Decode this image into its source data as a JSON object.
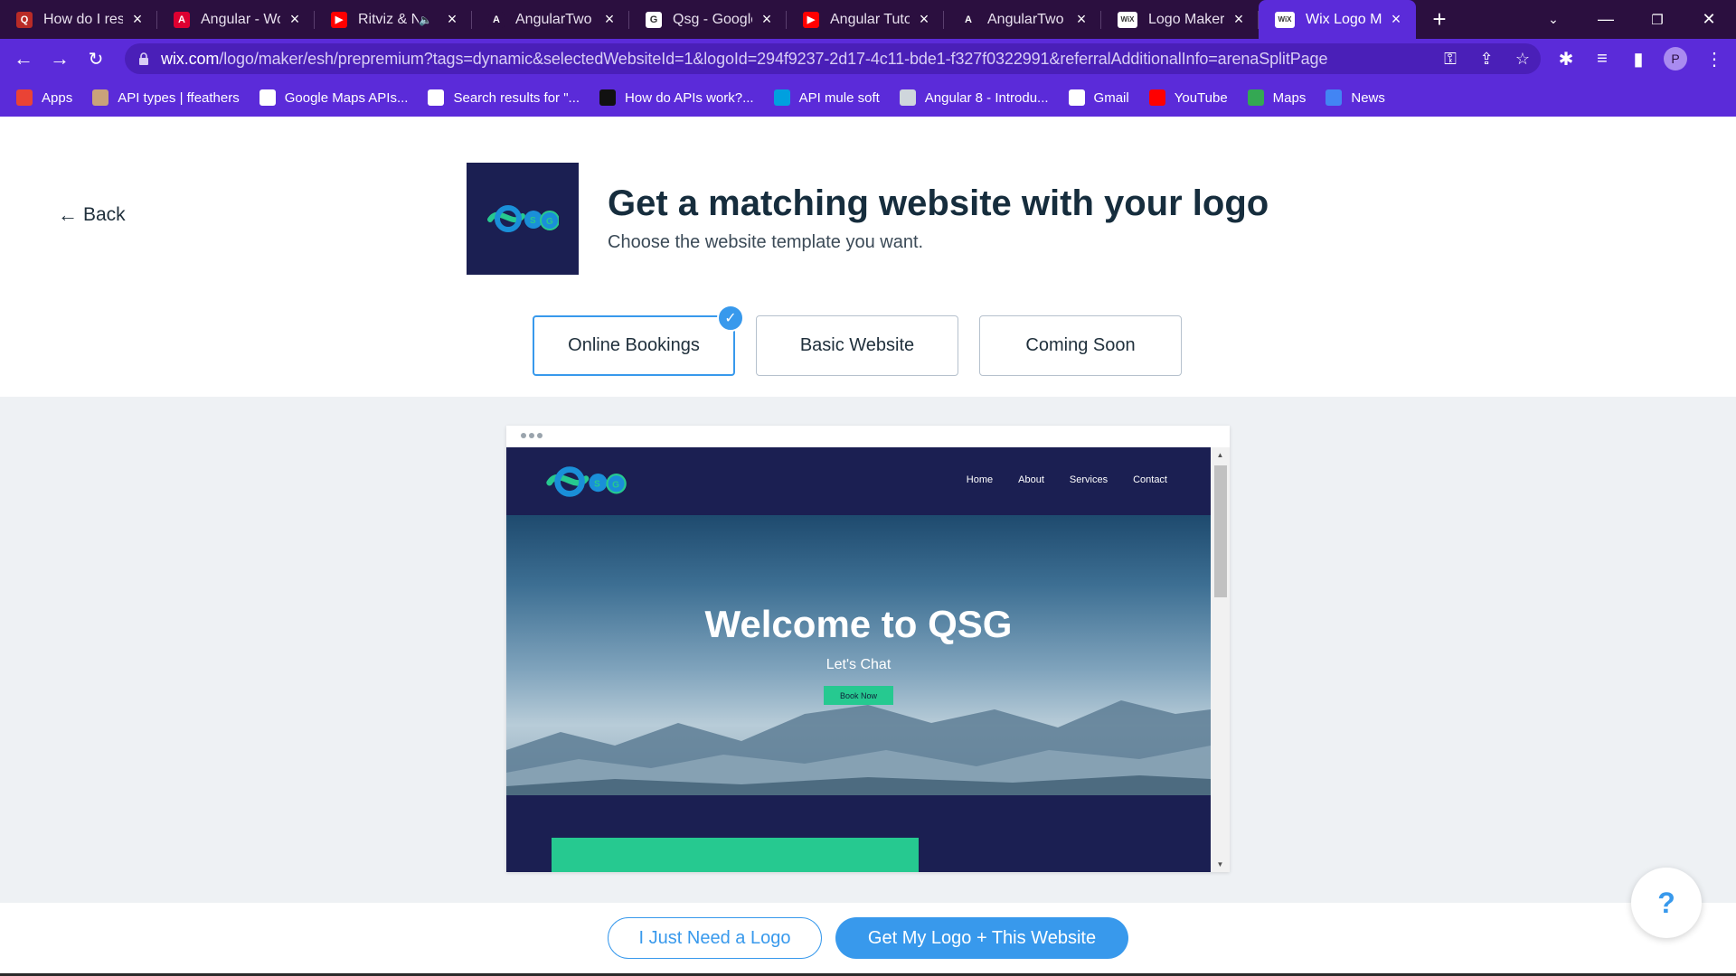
{
  "browser": {
    "tabs": [
      {
        "label": "How do I reso",
        "icon": "quora-icon",
        "color": "#b92b27",
        "glyph": "Q",
        "active": false,
        "audio": false
      },
      {
        "label": "Angular - Wor",
        "icon": "angular-icon",
        "color": "#dd0031",
        "glyph": "A",
        "active": false,
        "audio": false
      },
      {
        "label": "Ritviz & N",
        "icon": "youtube-icon",
        "color": "#ff0000",
        "glyph": "▶",
        "active": false,
        "audio": true
      },
      {
        "label": "AngularTwo",
        "icon": "angulartwo-icon",
        "color": "#2b0f3f",
        "glyph": "A",
        "active": false,
        "audio": false
      },
      {
        "label": "Qsg - Google",
        "icon": "google-icon",
        "color": "#ffffff",
        "glyph": "G",
        "active": false,
        "audio": false
      },
      {
        "label": "Angular Tutor",
        "icon": "youtube-icon",
        "color": "#ff0000",
        "glyph": "▶",
        "active": false,
        "audio": false
      },
      {
        "label": "AngularTwo",
        "icon": "angulartwo-icon",
        "color": "#2b0f3f",
        "glyph": "A",
        "active": false,
        "audio": false
      },
      {
        "label": "Logo Maker |",
        "icon": "wix-icon",
        "color": "#ffffff",
        "glyph": "WiX",
        "active": false,
        "audio": false
      },
      {
        "label": "Wix Logo Mak",
        "icon": "wix-icon",
        "color": "#ffffff",
        "glyph": "WiX",
        "active": true,
        "audio": false
      }
    ],
    "url_host": "wix.com",
    "url_rest": "/logo/maker/esh/prepremium?tags=dynamic&selectedWebsiteId=1&logoId=294f9237-2d17-4c11-bde1-f327f0322991&referralAdditionalInfo=arenaSplitPage",
    "profile_initial": "P",
    "bookmarks": [
      {
        "label": "Apps",
        "icon": "apps-grid-icon",
        "color": "#ea4335"
      },
      {
        "label": "API types | ffeathers",
        "icon": "ffeathers-icon",
        "color": "#c9a27a"
      },
      {
        "label": "Google Maps APIs...",
        "icon": "google-maps-api-icon",
        "color": "#ffffff"
      },
      {
        "label": "Search results for \"...",
        "icon": "search-results-icon",
        "color": "#ffffff"
      },
      {
        "label": "How do APIs work?...",
        "icon": "link-icon",
        "color": "#111111"
      },
      {
        "label": "API mule soft",
        "icon": "mulesoft-icon",
        "color": "#00a0df"
      },
      {
        "label": "Angular 8 - Introdu...",
        "icon": "angular8-icon",
        "color": "#cfd6dc"
      },
      {
        "label": "Gmail",
        "icon": "gmail-icon",
        "color": "#ffffff"
      },
      {
        "label": "YouTube",
        "icon": "youtube-icon",
        "color": "#ff0000"
      },
      {
        "label": "Maps",
        "icon": "maps-icon",
        "color": "#34a853"
      },
      {
        "label": "News",
        "icon": "news-icon",
        "color": "#4285f4"
      }
    ]
  },
  "page": {
    "back_label": "Back",
    "title": "Get a matching website with your logo",
    "subtitle": "Choose the website template you want.",
    "logo_text": "QSG",
    "templates": [
      {
        "label": "Online Bookings",
        "selected": true
      },
      {
        "label": "Basic Website",
        "selected": false
      },
      {
        "label": "Coming Soon",
        "selected": false
      }
    ],
    "preview": {
      "nav": [
        "Home",
        "About",
        "Services",
        "Contact"
      ],
      "hero_title": "Welcome to QSG",
      "hero_subtitle": "Let's Chat",
      "hero_button": "Book Now"
    },
    "secondary_button": "I Just Need a Logo",
    "primary_button": "Get My Logo + This Website",
    "help_label": "?"
  },
  "colors": {
    "accent": "#3899ec",
    "browser_purple": "#5b2bd9",
    "site_navy": "#1b1f52",
    "site_green": "#26c990"
  }
}
